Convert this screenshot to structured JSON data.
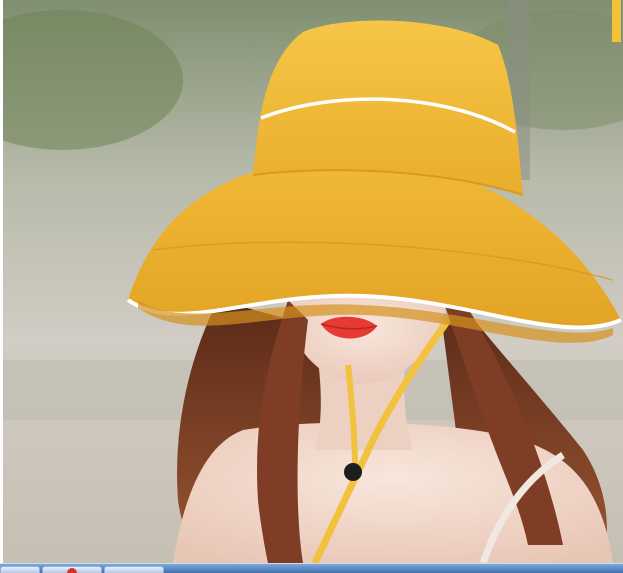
{
  "scene": {
    "subject": "woman-wearing-yellow-bucket-hat",
    "colors": {
      "hat": "#f4bf3a",
      "hat_shadow": "#d99a1c",
      "hat_trim": "#ffffff",
      "strap": "#f2c23e",
      "hair": "#7a3b22",
      "skin": "#f2d9cc",
      "lips": "#e63a32",
      "background_top": "#9aa58a",
      "background_bottom": "#c9c3b8"
    }
  },
  "taskbar": {
    "buttons": [
      {
        "icon": "window-icon"
      },
      {
        "icon": "browser-icon"
      },
      {
        "icon": "window-icon"
      }
    ]
  }
}
